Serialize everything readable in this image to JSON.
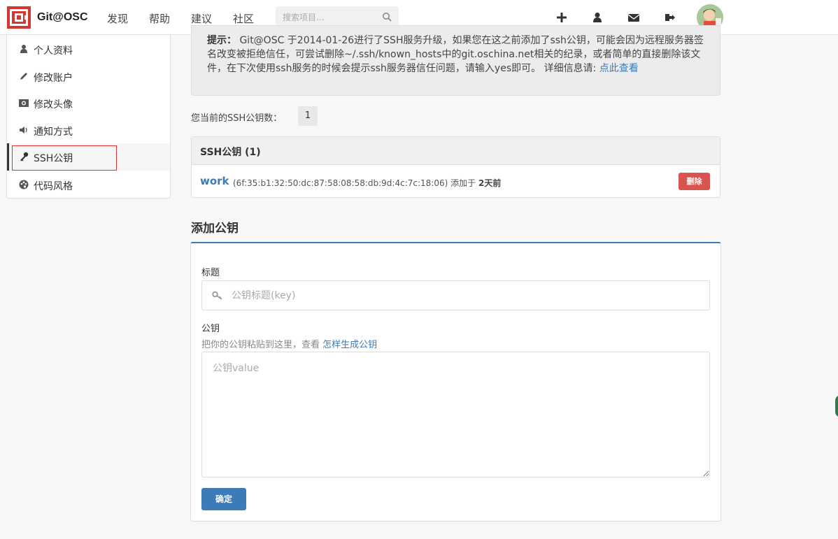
{
  "navbar": {
    "brand": "Git@OSC",
    "links": [
      "发现",
      "帮助",
      "建议",
      "社区"
    ],
    "search_placeholder": "搜索项目...",
    "icons": [
      "plus-icon",
      "user-icon",
      "envelope-icon",
      "logout-icon"
    ]
  },
  "sidebar": {
    "items": [
      {
        "label": "个人资料",
        "icon": "user-icon"
      },
      {
        "label": "修改账户",
        "icon": "pencil-icon"
      },
      {
        "label": "修改头像",
        "icon": "camera-icon"
      },
      {
        "label": "通知方式",
        "icon": "volume-icon"
      },
      {
        "label": "SSH公钥",
        "icon": "key-icon",
        "active": true
      },
      {
        "label": "代码风格",
        "icon": "palette-icon"
      }
    ]
  },
  "notice": {
    "label": "提示：",
    "text": " Git@OSC 于2014-01-26进行了SSH服务升级，如果您在这之前添加了ssh公钥，可能会因为远程服务器签名改变被拒绝信任，可尝试删除~/.ssh/known_hosts中的git.oschina.net相关的纪录，或者简单的直接删除该文件，在下次使用ssh服务的时候会提示ssh服务器信任问题，请输入yes即可。 详细信息请: ",
    "link": "点此查看"
  },
  "key_count": {
    "label": "您当前的SSH公钥数：",
    "value": "1"
  },
  "keys_panel": {
    "heading": "SSH公钥 (1)",
    "keys": [
      {
        "title": "work",
        "fingerprint": "(6f:35:b1:32:50:dc:87:58:08:58:db:9d:4c:7c:18:06)",
        "added_prefix": "添加于",
        "added": "2天前",
        "delete_label": "删除"
      }
    ]
  },
  "add_form": {
    "heading": "添加公钥",
    "title_label": "标题",
    "title_placeholder": "公钥标题(key)",
    "key_label": "公钥",
    "hint_text": "把你的公钥粘贴到这里，查看 ",
    "hint_link": "怎样生成公钥",
    "key_placeholder": "公钥value",
    "submit_label": "确定"
  },
  "colors": {
    "accent": "#3d7ab8",
    "danger": "#d9534f",
    "brand_red": "#d03a33"
  }
}
